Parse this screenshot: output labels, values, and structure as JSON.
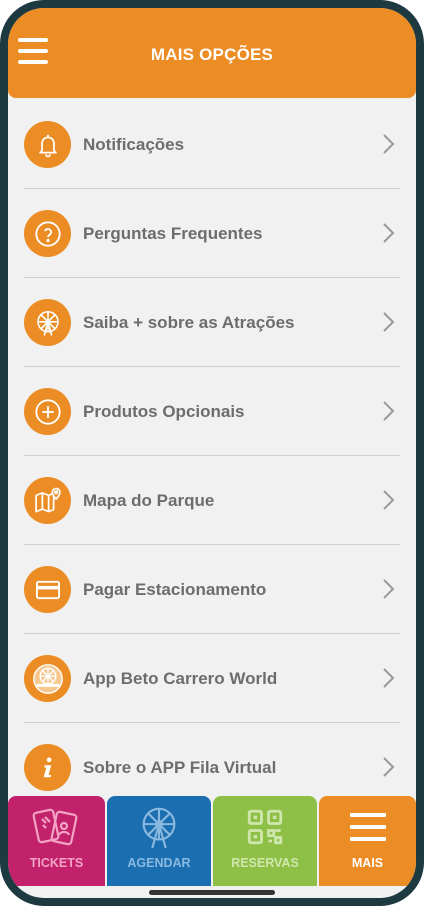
{
  "header": {
    "title": "MAIS OPÇÕES"
  },
  "menu": {
    "items": [
      {
        "label": "Notificações",
        "icon": "bell-icon"
      },
      {
        "label": "Perguntas Frequentes",
        "icon": "question-icon"
      },
      {
        "label": "Saiba + sobre as Atrações",
        "icon": "ferris-wheel-icon"
      },
      {
        "label": "Produtos Opcionais",
        "icon": "plus-circle-icon"
      },
      {
        "label": "Mapa do Parque",
        "icon": "map-icon"
      },
      {
        "label": "Pagar Estacionamento",
        "icon": "credit-card-icon"
      },
      {
        "label": "App Beto Carrero World",
        "icon": "beto-carrero-logo-icon"
      },
      {
        "label": "Sobre o APP Fila Virtual",
        "icon": "info-icon"
      }
    ]
  },
  "tabbar": {
    "tabs": [
      {
        "label": "TICKETS",
        "icon": "tickets-icon",
        "color": "#c2226b",
        "text_color": "#f3a3c4"
      },
      {
        "label": "AGENDAR",
        "icon": "ferris-wheel-icon",
        "color": "#1b6fb1",
        "text_color": "#8ab9e0"
      },
      {
        "label": "RESERVAS",
        "icon": "qr-code-icon",
        "color": "#8ec048",
        "text_color": "#cfe6ad"
      },
      {
        "label": "MAIS",
        "icon": "menu-icon",
        "color": "#ec8c24",
        "text_color": "#ffffff",
        "active": true
      }
    ]
  },
  "colors": {
    "accent": "#ec8c24",
    "background": "#f1f1f1",
    "label": "#6d6d6d"
  }
}
